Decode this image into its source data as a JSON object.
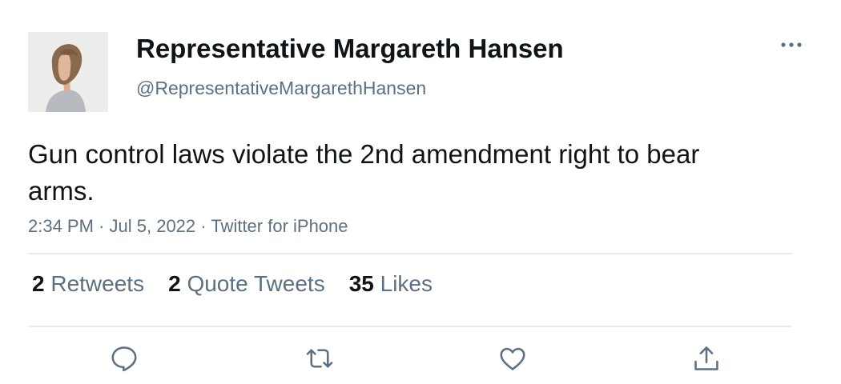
{
  "author": {
    "display_name": "Representative Margareth Hansen",
    "handle": "@RepresentativeMargarethHansen"
  },
  "tweet": {
    "text": "Gun control laws violate the 2nd amendment right to bear arms.",
    "time": "2:34 PM",
    "date": "Jul 5, 2022",
    "source": "Twitter for iPhone",
    "separator": "·"
  },
  "stats": {
    "retweets_count": "2",
    "retweets_label": "Retweets",
    "quotes_count": "2",
    "quotes_label": "Quote Tweets",
    "likes_count": "35",
    "likes_label": "Likes"
  },
  "icons": {
    "more": "more-icon",
    "reply": "reply-icon",
    "retweet": "retweet-icon",
    "like": "heart-icon",
    "share": "share-icon"
  },
  "colors": {
    "text": "#0f1419",
    "secondary": "#5b7083",
    "divider": "#e6ecf0"
  }
}
